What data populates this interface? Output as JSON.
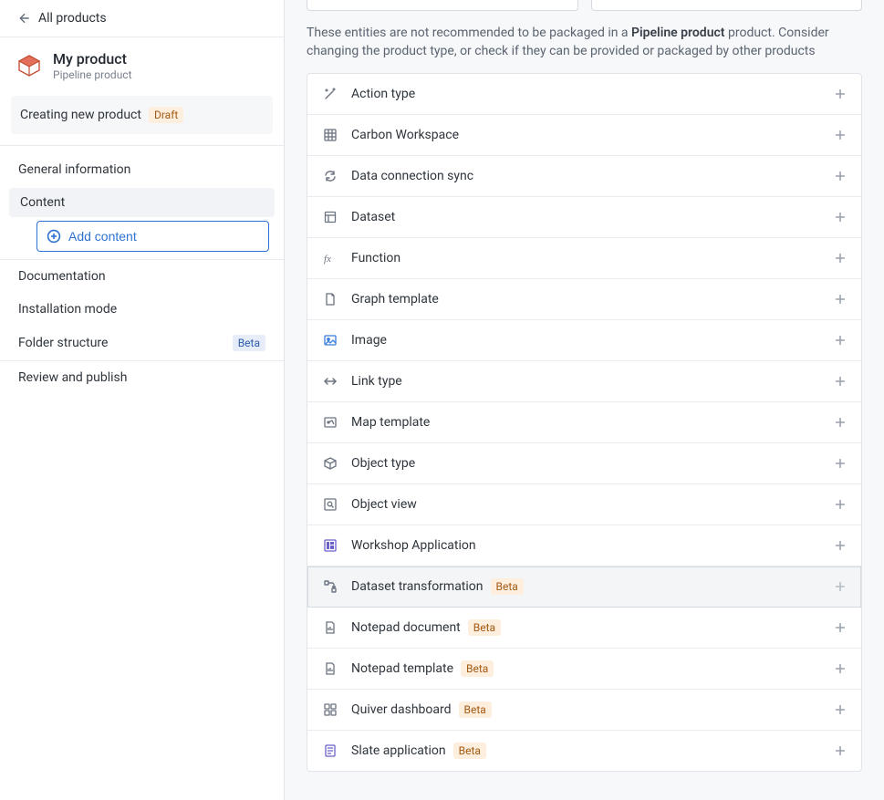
{
  "sidebar": {
    "back_label": "All products",
    "product_title": "My product",
    "product_subtitle": "Pipeline product",
    "status_text": "Creating new product",
    "status_badge": "Draft",
    "nav": {
      "general": "General information",
      "content": "Content",
      "add_content": "Add content",
      "documentation": "Documentation",
      "installation_mode": "Installation mode",
      "folder_structure": "Folder structure",
      "folder_structure_badge": "Beta",
      "review_publish": "Review and publish"
    }
  },
  "main": {
    "warning_prefix": "These entities are not recommended to be packaged in a ",
    "warning_strong": "Pipeline product",
    "warning_suffix": " product. Consider changing the product type, or check if they can be provided or packaged by other products",
    "entities": [
      {
        "label": "Action type",
        "icon": "wand",
        "beta": false,
        "highlighted": false
      },
      {
        "label": "Carbon Workspace",
        "icon": "grid",
        "beta": false,
        "highlighted": false
      },
      {
        "label": "Data connection sync",
        "icon": "sync",
        "beta": false,
        "highlighted": false
      },
      {
        "label": "Dataset",
        "icon": "dataset",
        "beta": false,
        "highlighted": false
      },
      {
        "label": "Function",
        "icon": "fx",
        "beta": false,
        "highlighted": false
      },
      {
        "label": "Graph template",
        "icon": "doc",
        "beta": false,
        "highlighted": false
      },
      {
        "label": "Image",
        "icon": "image",
        "beta": false,
        "highlighted": false
      },
      {
        "label": "Link type",
        "icon": "link",
        "beta": false,
        "highlighted": false
      },
      {
        "label": "Map template",
        "icon": "map",
        "beta": false,
        "highlighted": false
      },
      {
        "label": "Object type",
        "icon": "cube",
        "beta": false,
        "highlighted": false
      },
      {
        "label": "Object view",
        "icon": "search",
        "beta": false,
        "highlighted": false
      },
      {
        "label": "Workshop Application",
        "icon": "app",
        "beta": false,
        "highlighted": false
      },
      {
        "label": "Dataset transformation",
        "icon": "transform",
        "beta": true,
        "highlighted": true
      },
      {
        "label": "Notepad document",
        "icon": "docbar",
        "beta": true,
        "highlighted": false
      },
      {
        "label": "Notepad template",
        "icon": "docbar",
        "beta": true,
        "highlighted": false
      },
      {
        "label": "Quiver dashboard",
        "icon": "dashboard",
        "beta": true,
        "highlighted": false
      },
      {
        "label": "Slate application",
        "icon": "slate",
        "beta": true,
        "highlighted": false
      }
    ],
    "beta_label": "Beta"
  },
  "colors": {
    "accent": "#2d72d2",
    "border": "#e1e5ea",
    "muted": "#7a828e"
  }
}
